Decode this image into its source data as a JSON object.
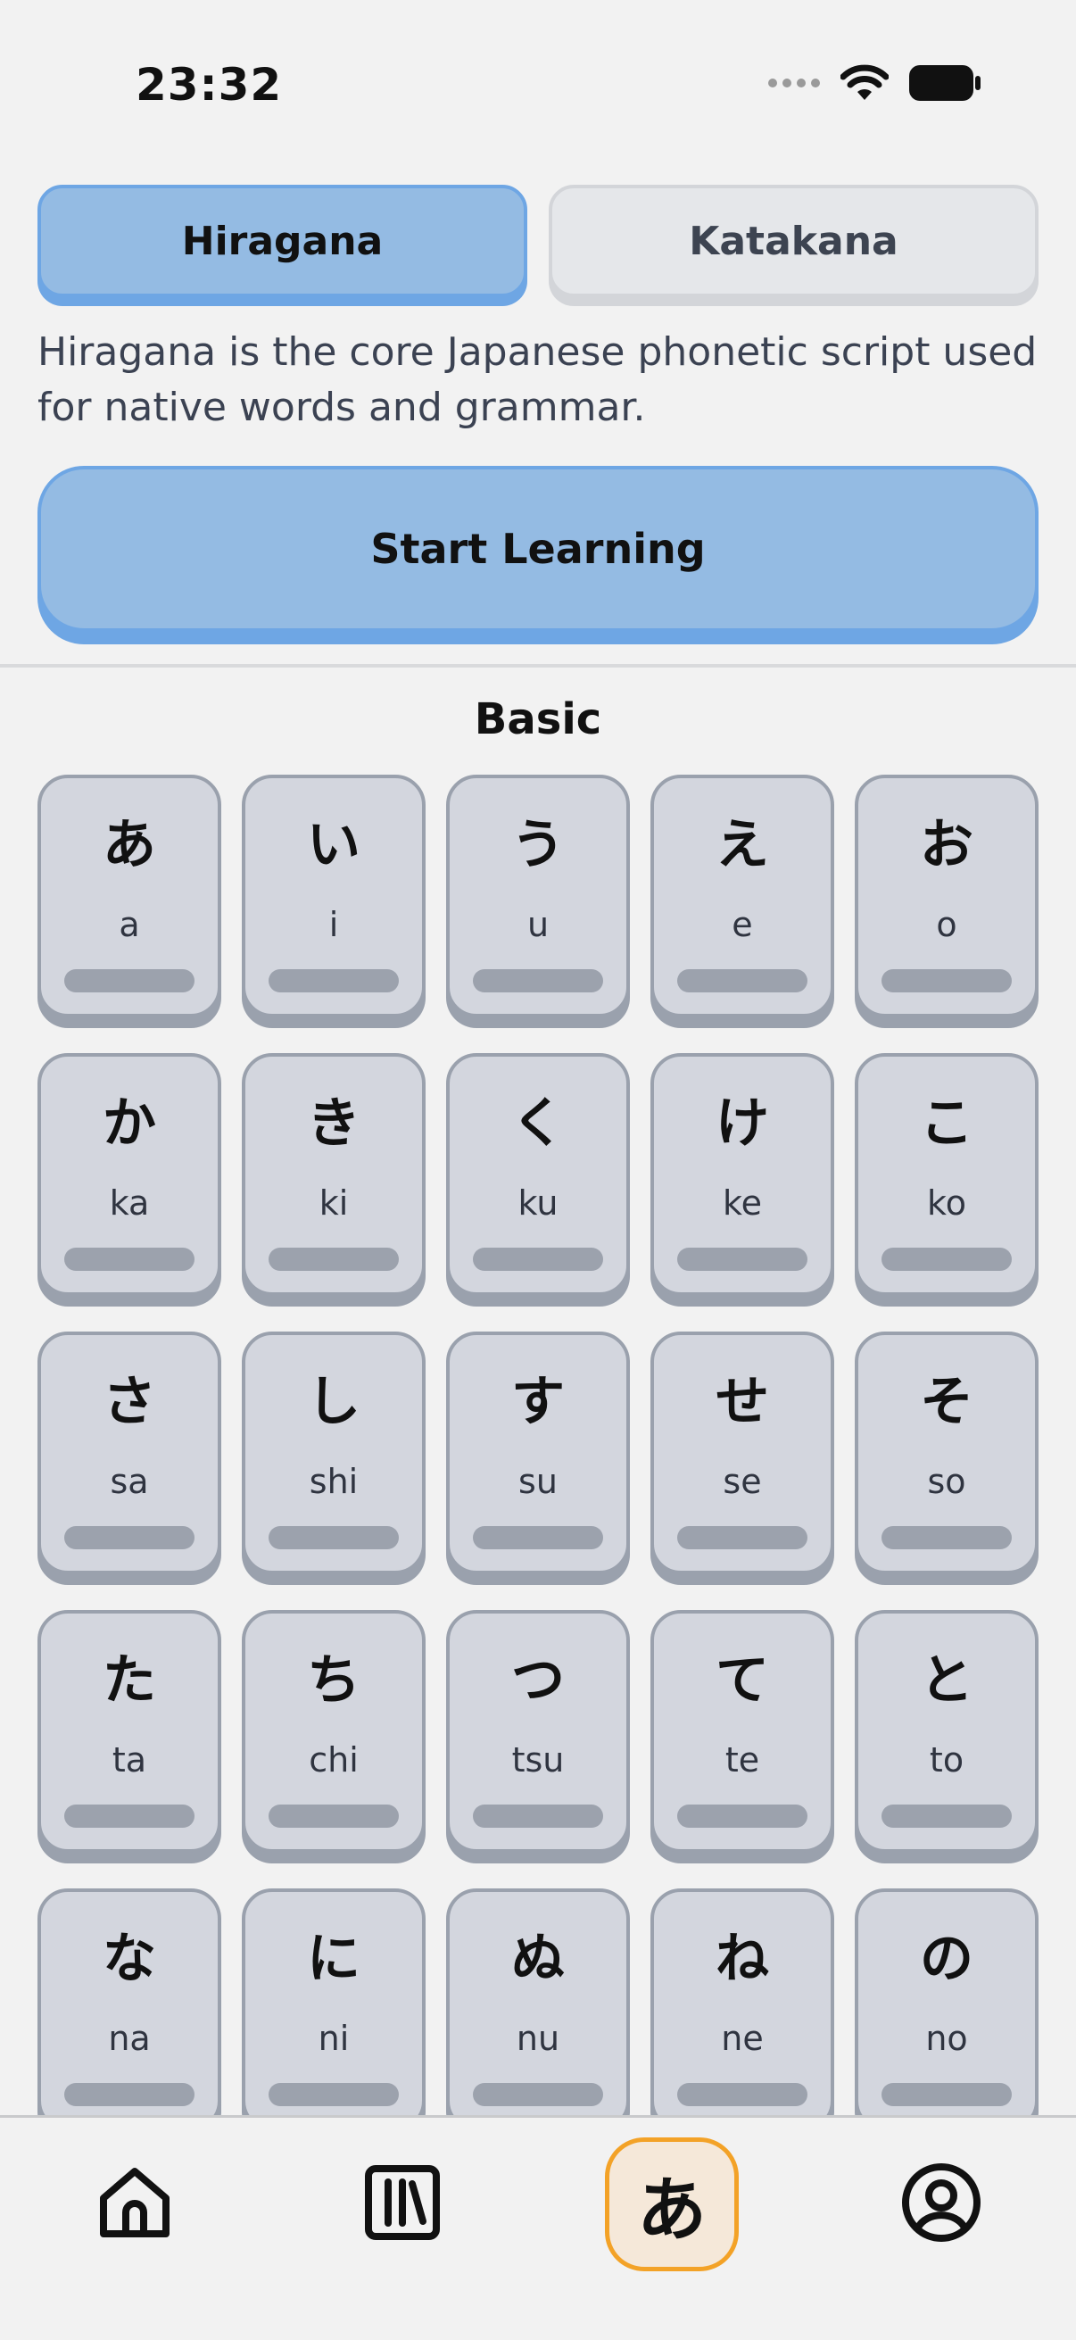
{
  "status": {
    "time": "23:32"
  },
  "script_toggle": {
    "hiragana_label": "Hiragana",
    "katakana_label": "Katakana"
  },
  "description": "Hiragana is the core Japanese phonetic script used for native words and grammar.",
  "start_button_label": "Start Learning",
  "section_title": "Basic",
  "cards": [
    {
      "kana": "あ",
      "romaji": "a"
    },
    {
      "kana": "い",
      "romaji": "i"
    },
    {
      "kana": "う",
      "romaji": "u"
    },
    {
      "kana": "え",
      "romaji": "e"
    },
    {
      "kana": "お",
      "romaji": "o"
    },
    {
      "kana": "か",
      "romaji": "ka"
    },
    {
      "kana": "き",
      "romaji": "ki"
    },
    {
      "kana": "く",
      "romaji": "ku"
    },
    {
      "kana": "け",
      "romaji": "ke"
    },
    {
      "kana": "こ",
      "romaji": "ko"
    },
    {
      "kana": "さ",
      "romaji": "sa"
    },
    {
      "kana": "し",
      "romaji": "shi"
    },
    {
      "kana": "す",
      "romaji": "su"
    },
    {
      "kana": "せ",
      "romaji": "se"
    },
    {
      "kana": "そ",
      "romaji": "so"
    },
    {
      "kana": "た",
      "romaji": "ta"
    },
    {
      "kana": "ち",
      "romaji": "chi"
    },
    {
      "kana": "つ",
      "romaji": "tsu"
    },
    {
      "kana": "て",
      "romaji": "te"
    },
    {
      "kana": "と",
      "romaji": "to"
    },
    {
      "kana": "な",
      "romaji": "na"
    },
    {
      "kana": "に",
      "romaji": "ni"
    },
    {
      "kana": "ぬ",
      "romaji": "nu"
    },
    {
      "kana": "ね",
      "romaji": "ne"
    },
    {
      "kana": "の",
      "romaji": "no"
    }
  ],
  "tab_bar": {
    "kana_tab_glyph": "あ",
    "icons": [
      "home-icon",
      "library-icon",
      "kana-icon",
      "profile-icon"
    ]
  },
  "colors": {
    "accent_blue": "#94bbe3",
    "accent_blue_border": "#6ea6e4",
    "active_tab": "#f3a227",
    "card_fill": "#d3d6de"
  }
}
